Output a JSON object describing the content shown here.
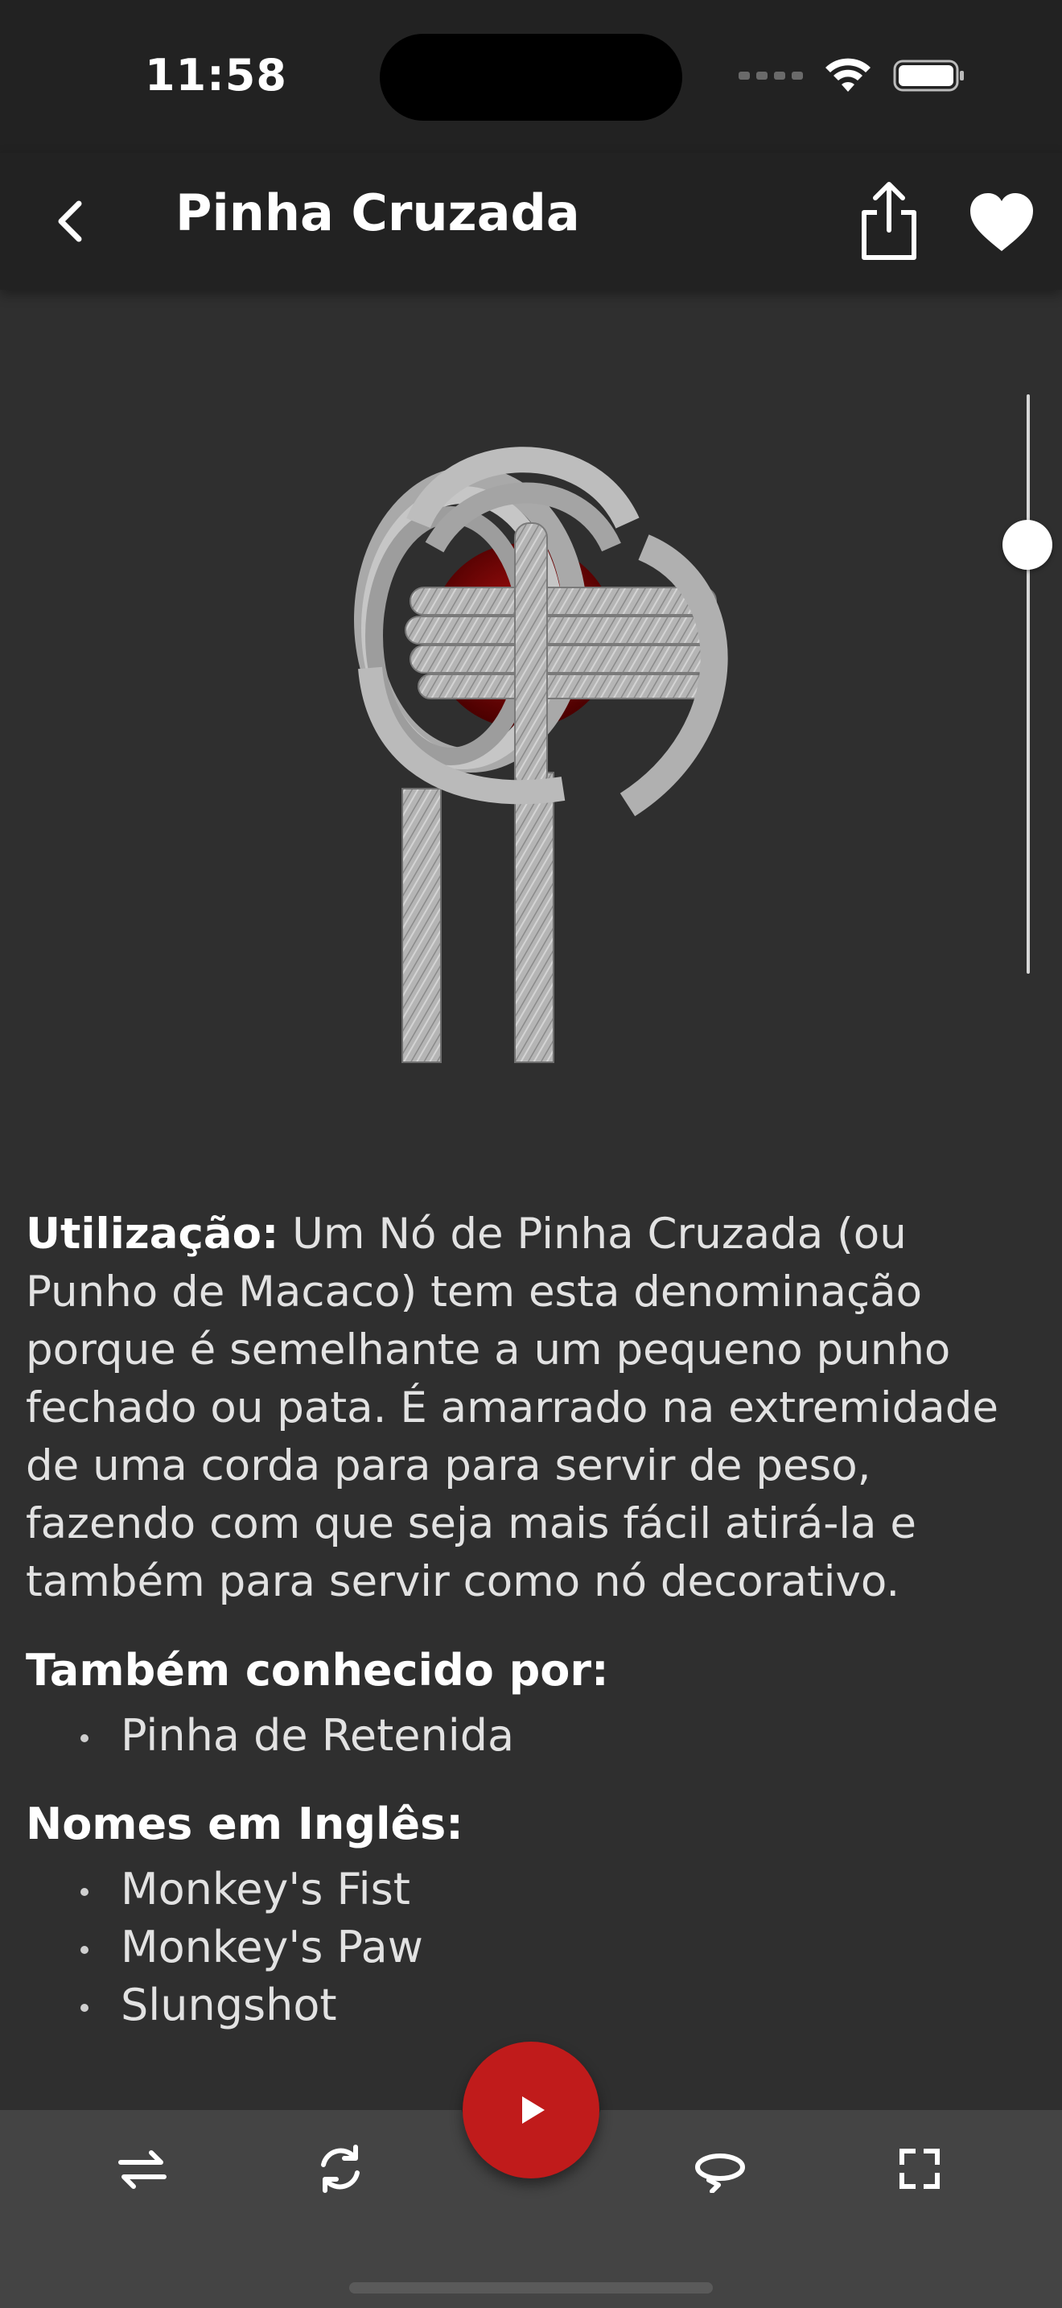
{
  "status": {
    "time": "11:58"
  },
  "nav": {
    "title": "Pinha Cruzada"
  },
  "description": {
    "usage_label": "Utilização:",
    "usage_text": "Um Nó de Pinha Cruzada (ou Punho de Macaco) tem esta denominação porque é semelhante a um pequeno punho fechado ou pata. É amarrado na extremidade de uma corda para para servir de peso, fazendo com que seja mais fácil atirá-la e também para servir como nó decorativo.",
    "also_known_title": "Também conhecido por:",
    "also_known": [
      "Pinha de Retenida"
    ],
    "english_title": "Nomes em Inglês:",
    "english_names": [
      "Monkey's Fist",
      "Monkey's Paw",
      "Slungshot"
    ]
  },
  "viewer": {
    "slider_level": 0.26
  },
  "toolbar": {
    "icons": [
      "swap-direction-icon",
      "rotate-icon",
      "play-icon",
      "loop-icon",
      "fullscreen-icon"
    ]
  },
  "colors": {
    "accent": "#c01b1b",
    "background": "#2f2f2f",
    "bar": "#222222",
    "bottom_bar": "#444444"
  }
}
